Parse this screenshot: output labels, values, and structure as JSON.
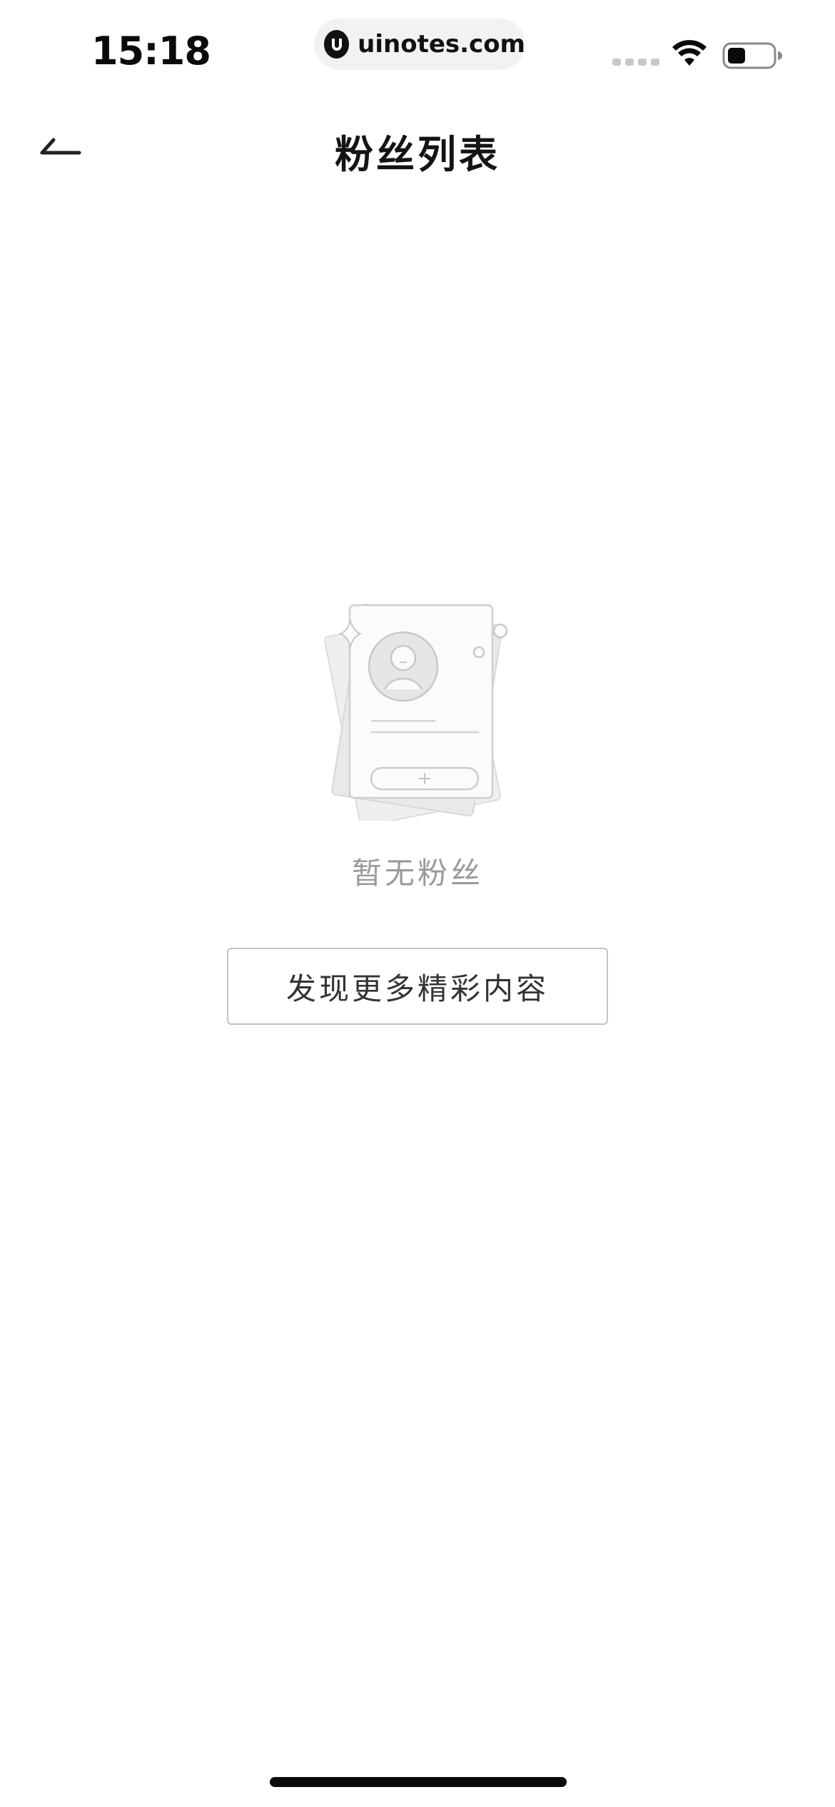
{
  "status_bar": {
    "time": "15:18",
    "url": "uinotes.com",
    "icons": [
      "cellular-signal-icon",
      "wifi-icon",
      "battery-icon"
    ]
  },
  "nav": {
    "back_icon": "back-arrow-icon",
    "title": "粉丝列表"
  },
  "empty_state": {
    "illustration": "empty-profile-card-illustration",
    "message": "暂无粉丝",
    "action_label": "发现更多精彩内容"
  },
  "colors": {
    "background": "#ffffff",
    "title_text": "#141414",
    "empty_text": "#9a9a9a",
    "button_border": "#c4c4c4",
    "button_text": "#333333"
  }
}
